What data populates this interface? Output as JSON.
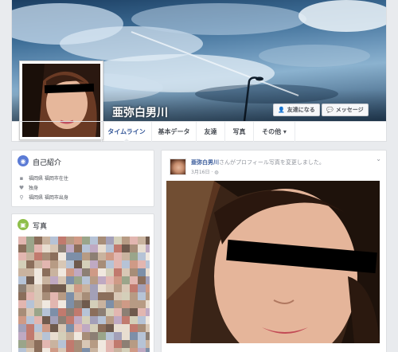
{
  "profile": {
    "name": "亜弥白男川"
  },
  "cover_actions": {
    "add_friend": "友達になる",
    "message": "メッセージ"
  },
  "nav_tabs": [
    {
      "label": "タイムライン",
      "active": true
    },
    {
      "label": "基本データ",
      "active": false
    },
    {
      "label": "友達",
      "active": false
    },
    {
      "label": "写真",
      "active": false
    },
    {
      "label": "その他 ▾",
      "active": false
    }
  ],
  "intro": {
    "title": "自己紹介",
    "rows": [
      {
        "icon": "briefcase-icon",
        "text": "福岡県 福岡市在住"
      },
      {
        "icon": "heart-icon",
        "text": "独身"
      },
      {
        "icon": "location-pin-icon",
        "text": "福岡県 福岡市出身"
      }
    ]
  },
  "photos": {
    "title": "写真"
  },
  "post": {
    "author": "亜弥白男川",
    "action": "さんがプロフィール写真を変更しました。",
    "time": "3月16日 · ",
    "privacy_icon": "globe-icon"
  },
  "colors": {
    "link_blue": "#365899",
    "background": "#e9ebee",
    "censor": "#000000"
  }
}
